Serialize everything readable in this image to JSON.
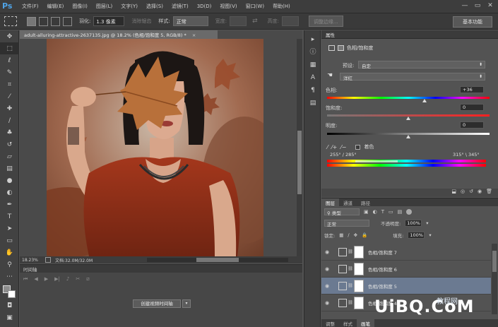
{
  "app": {
    "logo": "Ps"
  },
  "menu": [
    "文件(F)",
    "编辑(E)",
    "图像(I)",
    "图层(L)",
    "文字(Y)",
    "选择(S)",
    "滤镜(T)",
    "3D(D)",
    "视图(V)",
    "窗口(W)",
    "帮助(H)"
  ],
  "window_controls": {
    "minimize": "—",
    "maximize": "▭",
    "close": "✕"
  },
  "options": {
    "feather_label": "羽化:",
    "feather_value": "1.3 像素",
    "antialias_label": "消除锯齿",
    "style_label": "样式:",
    "style_value": "正常",
    "width_label": "宽度:",
    "height_label": "高度:",
    "refine_button": "调整边缘...",
    "workspace": "基本功能"
  },
  "document": {
    "tab_title": "adult-alluring-attractive-2637135.jpg @ 18.2% (色相/饱和度 5, RGB/8) *",
    "tab_close": "×",
    "zoom": "18.23%",
    "doc_info": "文档:32.0M/32.0M"
  },
  "timeline": {
    "title": "时间轴",
    "create_button": "创建视频时间轴",
    "dropdown_arrow": "▾"
  },
  "properties": {
    "tab": "属性",
    "title": "色相/饱和度",
    "preset_label": "预设:",
    "preset_value": "自定",
    "channel_value": "洋红",
    "hue_label": "色相:",
    "hue_value": "+36",
    "saturation_label": "饱和度:",
    "saturation_value": "0",
    "lightness_label": "明度:",
    "lightness_value": "0",
    "colorize_label": "着色",
    "range_left": "255° / 285°",
    "range_right": "315° \\ 345°",
    "hue_fraction": 0.6,
    "saturation_fraction": 0.5,
    "lightness_fraction": 0.5
  },
  "layers": {
    "tabs": [
      "图层",
      "通道",
      "路径"
    ],
    "filter_value": "类型",
    "blend_mode": "正常",
    "opacity_label": "不透明度:",
    "opacity_value": "100%",
    "lock_label": "锁定:",
    "fill_label": "填充:",
    "fill_value": "100%",
    "items": [
      {
        "name": "色相/饱和度 7"
      },
      {
        "name": "色相/饱和度 6"
      },
      {
        "name": "色相/饱和度 5"
      },
      {
        "name": "色相/饱和度 4"
      }
    ],
    "bottom_tabs": [
      "调整",
      "样式",
      "画笔"
    ]
  },
  "watermark": {
    "main": "UiBQ.CoM",
    "sub": "教程网"
  },
  "colors": {
    "accent": "#4fa3e6",
    "selected_layer": "#6b7a91"
  }
}
